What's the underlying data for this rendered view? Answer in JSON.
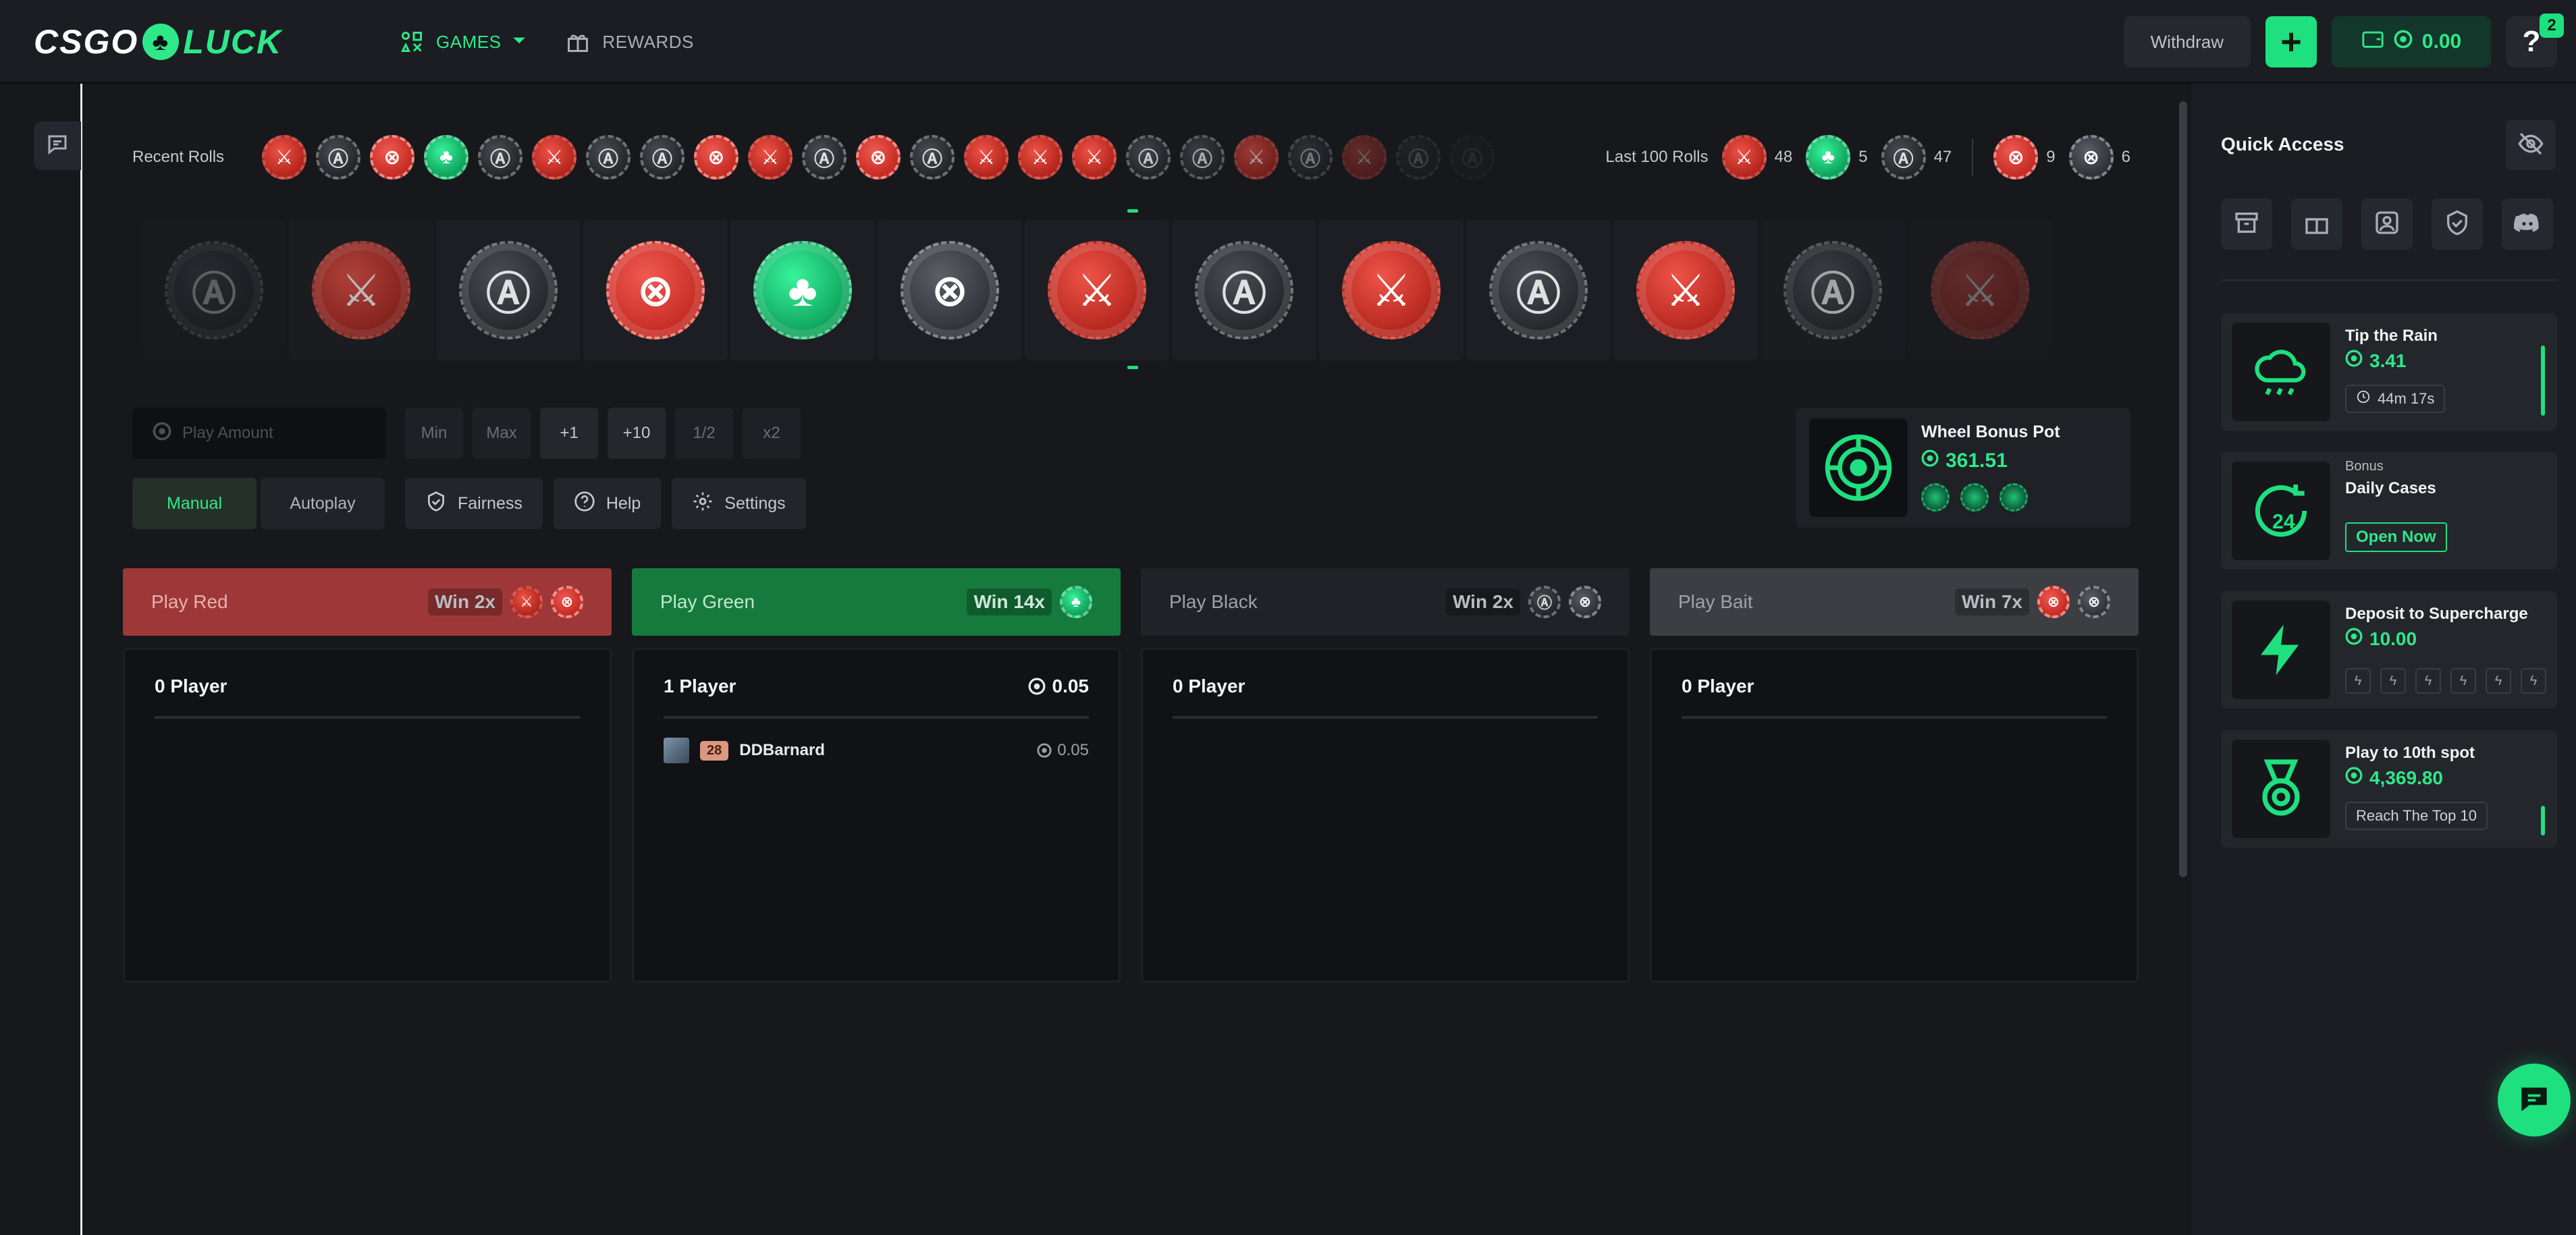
{
  "brand": {
    "part1": "CSGO",
    "part2": "LUCK",
    "clover": "♣"
  },
  "nav": {
    "games": "GAMES",
    "rewards": "REWARDS"
  },
  "topbar": {
    "withdraw": "Withdraw",
    "plus": "+",
    "balance": "0.00",
    "help": "?",
    "help_badge": "2"
  },
  "recent": {
    "label": "Recent Rolls",
    "rolls": [
      "red",
      "black",
      "bait-red",
      "green",
      "black",
      "red",
      "black",
      "black",
      "bait-red",
      "red",
      "black",
      "bait-red",
      "black",
      "red",
      "red",
      "red",
      "black",
      "black",
      "red",
      "black",
      "red",
      "black",
      "black"
    ]
  },
  "last100": {
    "label": "Last 100 Rolls",
    "red": "48",
    "green": "5",
    "black": "47",
    "bait_red": "9",
    "bait_black": "6"
  },
  "wheel": {
    "slots": [
      "black",
      "red",
      "black",
      "bait-red",
      "green",
      "bait",
      "red",
      "black",
      "red",
      "black",
      "red",
      "black",
      "red"
    ]
  },
  "controls": {
    "placeholder": "Play Amount",
    "min": "Min",
    "max": "Max",
    "plus1": "+1",
    "plus10": "+10",
    "half": "1/2",
    "double": "x2",
    "manual": "Manual",
    "autoplay": "Autoplay",
    "fairness": "Fairness",
    "help": "Help",
    "settings": "Settings"
  },
  "bonus": {
    "title": "Wheel Bonus Pot",
    "value": "361.51"
  },
  "columns": [
    {
      "name": "Play Red",
      "win": "Win 2x",
      "players": "0 Player",
      "total": "",
      "color": "#9e3838"
    },
    {
      "name": "Play Green",
      "win": "Win 14x",
      "players": "1 Player",
      "total": "0.05",
      "color": "#167a3c"
    },
    {
      "name": "Play Black",
      "win": "Win 2x",
      "players": "0 Player",
      "total": "",
      "color": "#1f2227"
    },
    {
      "name": "Play Bait",
      "win": "Win 7x",
      "players": "0 Player",
      "total": "",
      "color": "#3c3e43"
    }
  ],
  "green_player": {
    "level": "28",
    "name": "DDBarnard",
    "amount": "0.05"
  },
  "quick": {
    "title": "Quick Access",
    "tip": {
      "title": "Tip the Rain",
      "value": "3.41",
      "timer": "44m 17s"
    },
    "cases": {
      "sub": "Bonus",
      "title": "Daily Cases",
      "cta": "Open Now"
    },
    "deposit": {
      "title": "Deposit to Supercharge",
      "value": "10.00"
    },
    "top10": {
      "title": "Play to 10th spot",
      "value": "4,369.80",
      "pill": "Reach The Top 10"
    }
  },
  "colors": {
    "accent": "#1ee07f",
    "red": "#c0322a",
    "green": "#18a35d",
    "black": "#2a2c31"
  }
}
